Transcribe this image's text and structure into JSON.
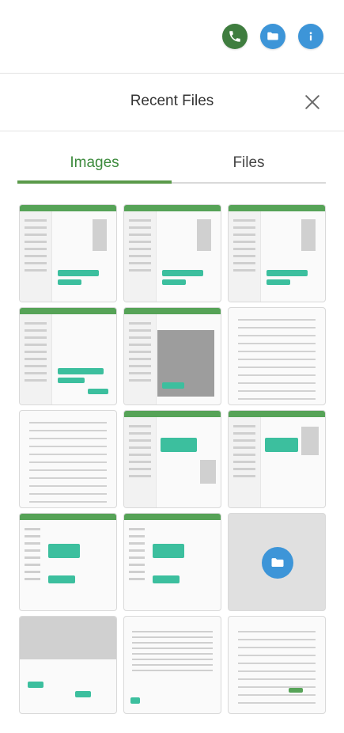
{
  "header": {
    "title": "Recent Files"
  },
  "tabs": [
    {
      "label": "Images",
      "active": true
    },
    {
      "label": "Files",
      "active": false
    }
  ],
  "colors": {
    "call_green": "#3f7d3f",
    "blue": "#3d95d8",
    "accent_green": "#5a9a4a"
  },
  "icons": {
    "phone": "phone-icon",
    "folder": "folder-icon",
    "info": "info-icon",
    "close": "close-icon"
  }
}
